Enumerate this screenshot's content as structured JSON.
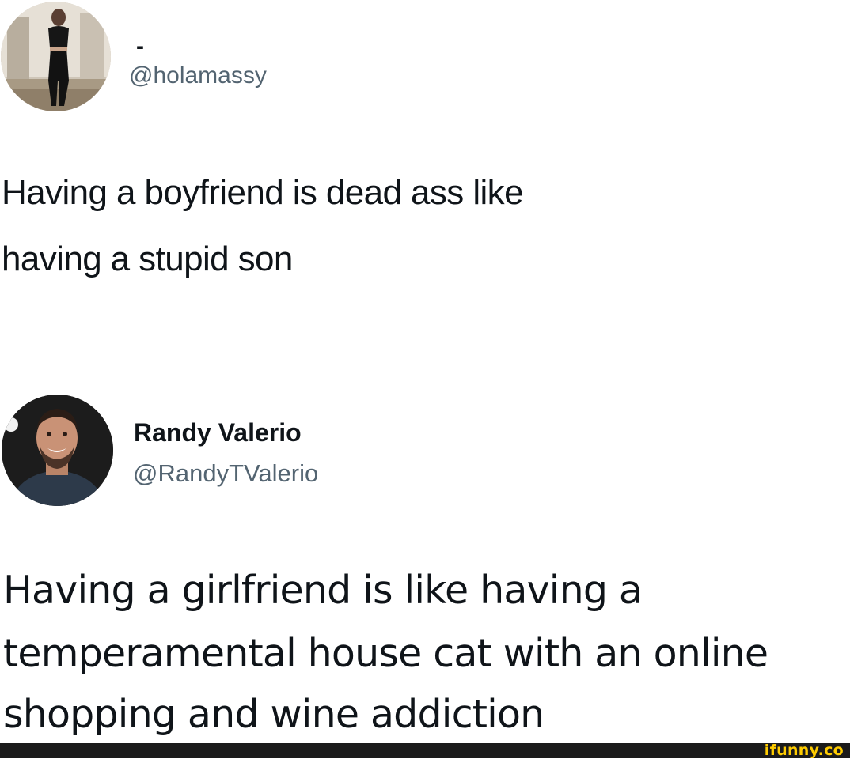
{
  "tweet1": {
    "display_name": "-",
    "handle": "@holamassy",
    "text_line1": "Having a boyfriend is dead ass like",
    "text_line2": "having a stupid son"
  },
  "tweet2": {
    "display_name": "Randy Valerio",
    "handle": "@RandyTValerio",
    "text_line1": "Having a girlfriend is like having a",
    "text_line2": "temperamental house cat with an online",
    "text_line3": "shopping and wine addiction"
  },
  "footer": {
    "watermark": "ifunny.co"
  }
}
